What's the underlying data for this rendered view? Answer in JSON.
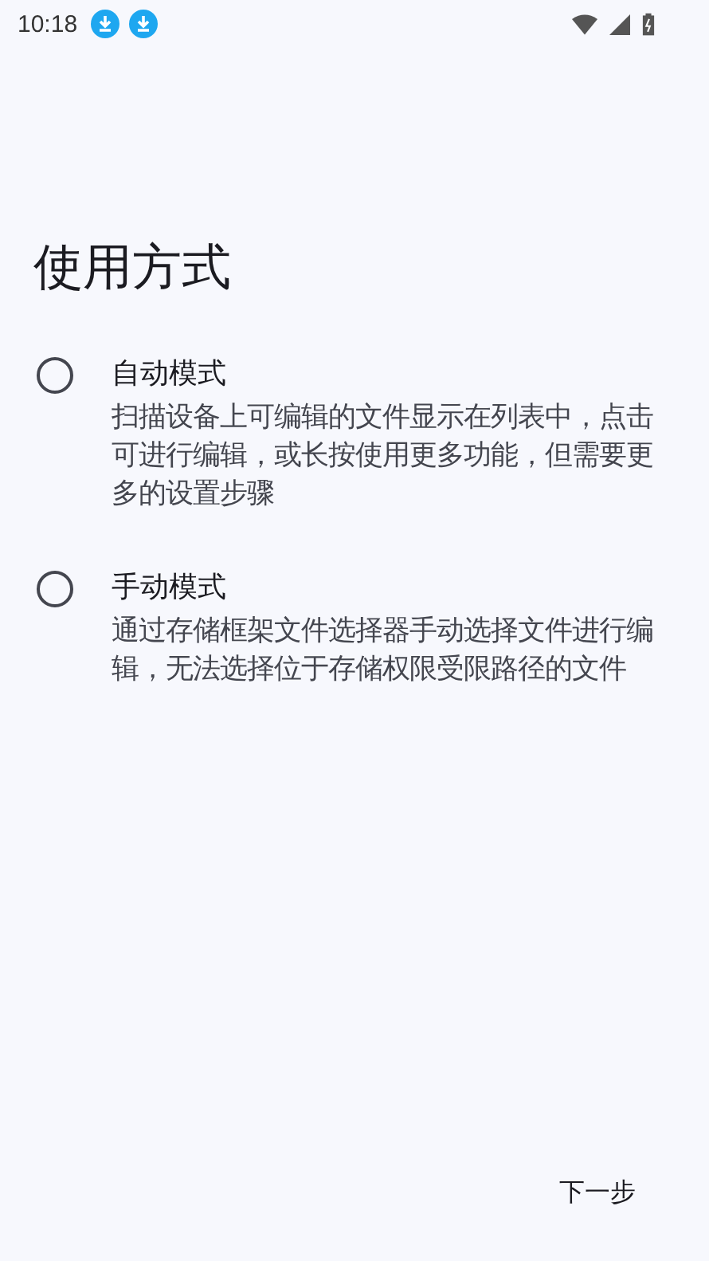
{
  "status_bar": {
    "time": "10:18",
    "notifications": [
      {
        "kind": "download"
      },
      {
        "kind": "download"
      }
    ]
  },
  "title": "使用方式",
  "options": [
    {
      "label": "自动模式",
      "description": "扫描设备上可编辑的文件显示在列表中，点击可进行编辑，或长按使用更多功能，但需要更多的设置步骤",
      "selected": false
    },
    {
      "label": "手动模式",
      "description": "通过存储框架文件选择器手动选择文件进行编辑，无法选择位于存储权限受限路径的文件",
      "selected": false
    }
  ],
  "next_button": "下一步"
}
